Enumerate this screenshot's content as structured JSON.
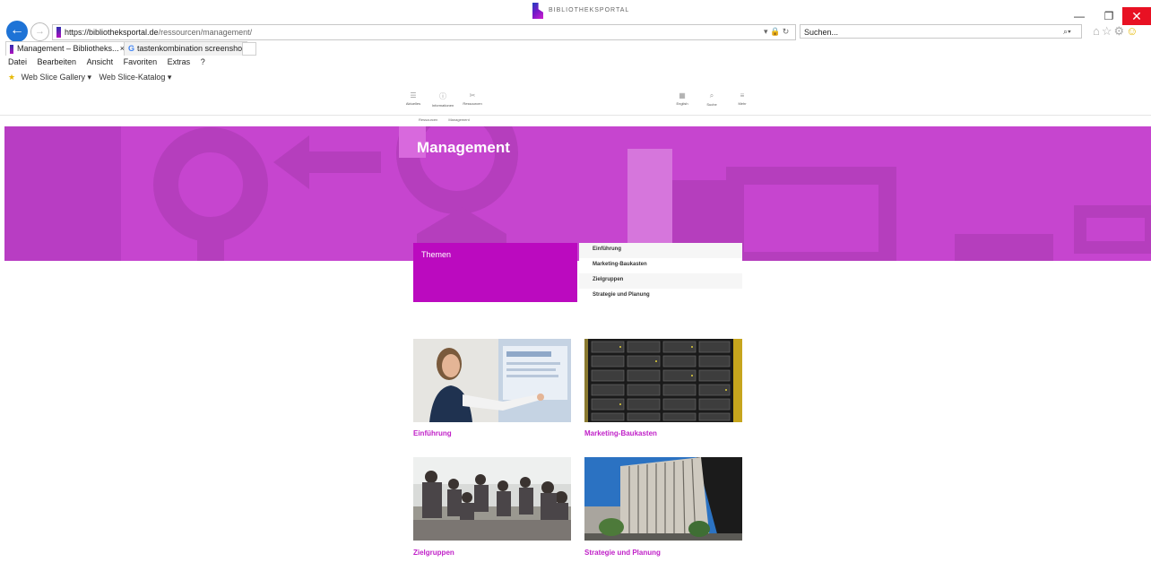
{
  "browser": {
    "url_host": "https://bibliotheksportal.de",
    "url_path": "/ressourcen/management/",
    "search_placeholder": "Suchen...",
    "tabs": [
      {
        "label": "Management – Bibliotheks...",
        "close": "×"
      },
      {
        "label": "tastenkombination screenshot ..."
      }
    ],
    "menu": [
      "Datei",
      "Bearbeiten",
      "Ansicht",
      "Favoriten",
      "Extras",
      "?"
    ],
    "favorites": [
      "Web Slice Gallery ▾",
      "Web Slice-Katalog ▾"
    ]
  },
  "site": {
    "nav_left": [
      {
        "label": "Aktuelles",
        "icon": "list-icon"
      },
      {
        "label": "Informationen",
        "icon": "info-icon"
      },
      {
        "label": "Ressourcen",
        "icon": "tools-icon"
      }
    ],
    "logo_text": "BIBLIOTHEKSPORTAL",
    "nav_right": [
      {
        "label": "English",
        "icon": "flag-icon"
      },
      {
        "label": "Suche",
        "icon": "search-icon"
      },
      {
        "label": "Mehr",
        "icon": "menu-icon"
      }
    ],
    "breadcrumb": [
      "Ressourcen",
      "Management"
    ]
  },
  "hero": {
    "title": "Management",
    "color": "#c645cf"
  },
  "themen": {
    "label": "Themen",
    "items": [
      "Einführung",
      "Marketing-Baukasten",
      "Zielgruppen",
      "Strategie und Planung"
    ]
  },
  "cards": [
    {
      "title": "Einführung"
    },
    {
      "title": "Marketing-Baukasten"
    },
    {
      "title": "Zielgruppen"
    },
    {
      "title": "Strategie und Planung"
    }
  ],
  "colors": {
    "accent": "#c021c8",
    "themen_bg": "#bb0abf"
  }
}
